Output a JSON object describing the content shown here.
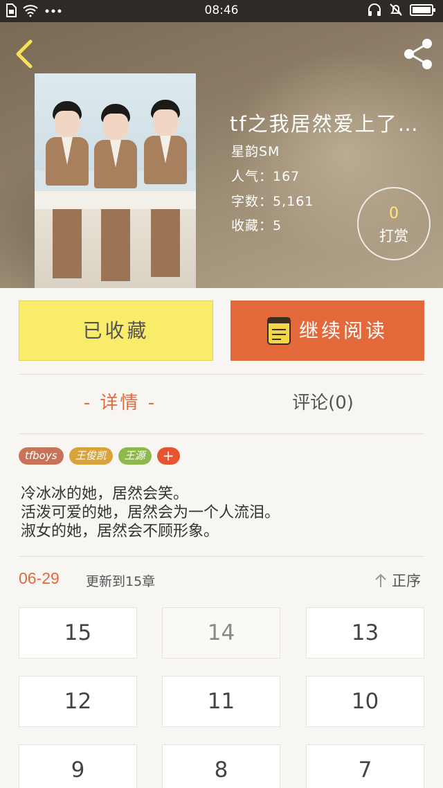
{
  "status_bar": {
    "time": "08:46"
  },
  "book": {
    "title": "tf之我居然爱上了…",
    "author": "星韵SM",
    "popularity_label": "人气：167",
    "word_count_label": "字数：5,161",
    "favorites_label": "收藏：5"
  },
  "reward": {
    "count": "0",
    "label": "打赏"
  },
  "actions": {
    "favorited_label": "已收藏",
    "continue_label": "继续阅读"
  },
  "tabs": {
    "detail": "- 详情 -",
    "comments": "评论(0)"
  },
  "tags": [
    {
      "label": "tfboys",
      "color": "#c7735a"
    },
    {
      "label": "王俊凯",
      "color": "#d9a33c"
    },
    {
      "label": "王源",
      "color": "#8fb94c"
    }
  ],
  "description": [
    "冷冰冰的她，居然会笑。",
    "活泼可爱的她，居然会为一个人流泪。",
    "淑女的她，居然会不顾形象。"
  ],
  "update": {
    "date": "06-29",
    "text": "更新到15章",
    "sort_label": "正序"
  },
  "chapters": [
    "15",
    "14",
    "13",
    "12",
    "11",
    "10",
    "9",
    "8",
    "7"
  ],
  "colors": {
    "accent": "#e4693a",
    "favorite_yellow": "#f9ec6a"
  }
}
